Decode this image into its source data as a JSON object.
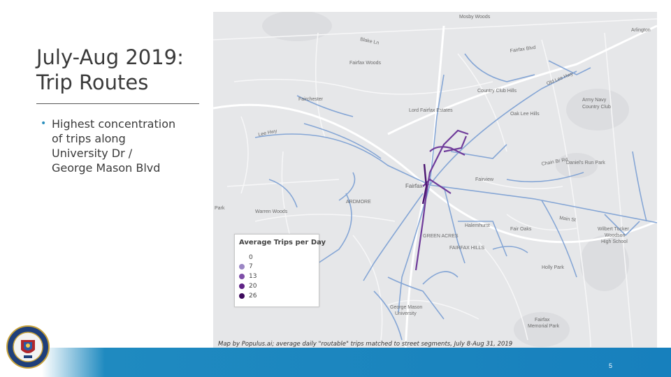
{
  "slide": {
    "title_lines": [
      "July-Aug 2019:",
      "Trip Routes"
    ],
    "bullet_lines": [
      "Highest concentration",
      "of trips along",
      "University Dr /",
      "George Mason Blvd"
    ],
    "page_number": "5"
  },
  "map": {
    "caption": "Map by Populus.ai; average daily \"routable\" trips matched to street segments, July 8-Aug 31, 2019",
    "labels": {
      "mosby_woods": "Mosby Woods",
      "fairfax_woods": "Fairfax Woods",
      "fairchester": "Fairchester",
      "lord_fairfax_estates": "Lord Fairfax Estates",
      "country_club_hills": "Country Club Hills",
      "oak_lee_hills": "Oak Lee Hills",
      "army_navy": "Army Navy",
      "country_club": "Country Club",
      "daniels_run_park": "Daniel's Run Park",
      "fairview": "Fairview",
      "fairfax": "Fairfax",
      "ardmore": "ARDMORE",
      "warren_woods": "Warren Woods",
      "halemhurst": "Halemhurst",
      "fair_oaks": "Fair Oaks",
      "green_acres": "GREEN ACRES",
      "fairfax_hills": "FAIRFAX HILLS",
      "holly_park": "Holly Park",
      "george_mason": "George Mason",
      "university": "University",
      "wilbert_tucker_1": "Wilbert Tucker",
      "wilbert_tucker_2": "Woodson",
      "wilbert_tucker_3": "High School",
      "fairfax_memorial_1": "Fairfax",
      "fairfax_memorial_2": "Memorial Park",
      "arlington": "Arlington",
      "park": "Park",
      "fairfax_blvd": "Fairfax Blvd",
      "main_st": "Main St",
      "lee_hwy": "Lee Hwy",
      "old_lee_hwy": "Old Lee Hwy",
      "chain_br_rd": "Chain Br Rd",
      "blake_ln": "Blake Ln"
    }
  },
  "legend": {
    "title": "Average Trips per Day",
    "items": [
      {
        "label": "0",
        "color": ""
      },
      {
        "label": "7",
        "color": "#9b86c4"
      },
      {
        "label": "13",
        "color": "#7e4fa8"
      },
      {
        "label": "20",
        "color": "#5f2386"
      },
      {
        "label": "26",
        "color": "#3d0a5c"
      }
    ]
  },
  "colors": {
    "accent": "#1780bd",
    "bullet": "#2a8fbd",
    "map_bg": "#e8e9eb",
    "route": "#7b9fd3",
    "route_high": "#5f2386"
  }
}
